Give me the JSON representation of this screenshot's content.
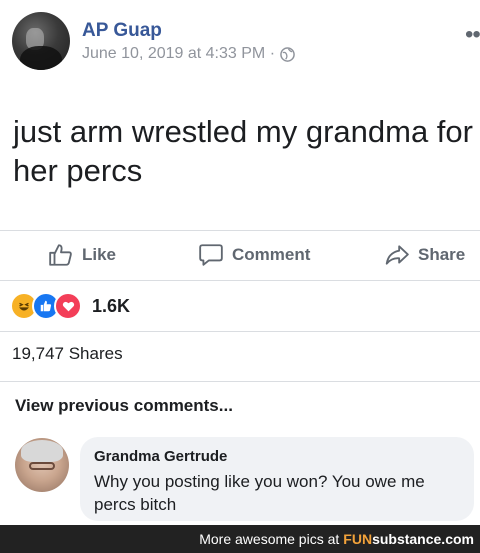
{
  "post": {
    "author": "AP Guap",
    "timestamp": "June 10, 2019 at 4:33 PM ·",
    "text": "just arm wrestled my grandma for her percs"
  },
  "actions": {
    "like": "Like",
    "comment": "Comment",
    "share": "Share"
  },
  "reactions": {
    "types": [
      "haha",
      "like",
      "love"
    ],
    "count": "1.6K"
  },
  "shares": "19,747 Shares",
  "comments": {
    "view_previous": "View previous comments...",
    "items": [
      {
        "name": "Grandma Gertrude",
        "text": "Why you posting like you won? You owe me percs bitch"
      }
    ]
  },
  "footer": {
    "text": "More awesome pics at",
    "brand_prefix": "FUN",
    "brand_suffix": "substance.com"
  },
  "colors": {
    "author_link": "#385898",
    "muted": "#90949c",
    "bubble": "#f0f2f5"
  }
}
